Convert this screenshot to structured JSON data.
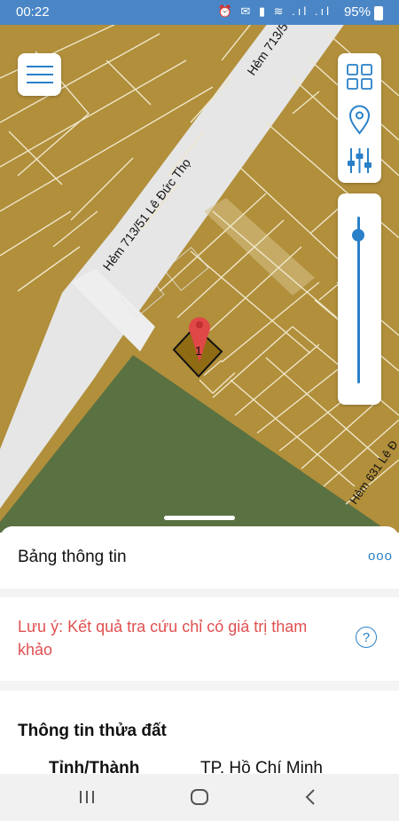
{
  "status_bar": {
    "time": "00:22",
    "battery": "95%"
  },
  "map": {
    "street_labels": [
      "Hẻm 713/5",
      "Hẻm 713/51 Lê Đức Thọ",
      "Hẻm 631 Lê Đ"
    ],
    "marker_label": "1"
  },
  "panel": {
    "title": "Bảng thông tin",
    "more_label": "ooo",
    "notice": "Lưu ý: Kết quả tra cứu chỉ có giá trị tham khảo",
    "help_label": "?",
    "section_title": "Thông tin thửa đất",
    "rows": [
      {
        "label": "Tỉnh/Thành",
        "value": "TP. Hồ Chí Minh"
      }
    ]
  },
  "zoom_level": 0.9,
  "colors": {
    "accent": "#2a80c8",
    "parcel": "#b18f3b",
    "green_area": "#5a7142",
    "notice": "#e05050",
    "status_bar": "#4a86c6"
  }
}
